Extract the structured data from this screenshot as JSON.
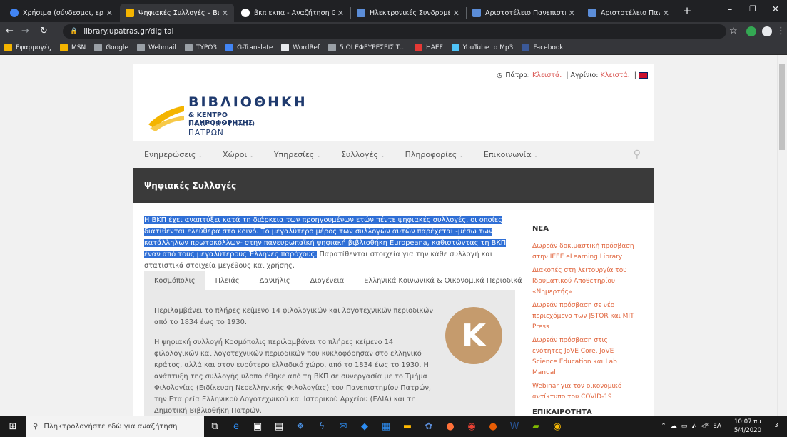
{
  "browser": {
    "tabs": [
      {
        "label": "Χρήσιμα (σύνδεσμοι, εργαλε",
        "color": "#4285f4"
      },
      {
        "label": "Ψηφιακές Συλλογές – Βιβλιοθ",
        "color": "#f4b400"
      },
      {
        "label": "βκπ εκπα - Αναζήτηση Goog",
        "color": "#ffffff"
      },
      {
        "label": "Ηλεκτρονικές Συνδρομές | Α",
        "color": "#5b8dd8"
      },
      {
        "label": "Αριστοτέλειο Πανεπιστήμιο",
        "color": "#5b8dd8"
      },
      {
        "label": "Αριστοτέλειο Πανεπιστήμιο",
        "color": "#5b8dd8"
      }
    ],
    "new_tab": "+",
    "address": "library.upatras.gr/digital",
    "bookmarks": [
      {
        "label": "Εφαρμογές",
        "color": "#f4b400"
      },
      {
        "label": "MSN",
        "color": "#f4b400"
      },
      {
        "label": "Google",
        "color": "#9aa0a6"
      },
      {
        "label": "Webmail",
        "color": "#9aa0a6"
      },
      {
        "label": "TYPO3",
        "color": "#9aa0a6"
      },
      {
        "label": "G-Translate",
        "color": "#4285f4"
      },
      {
        "label": "WordRef",
        "color": "#e8eaed"
      },
      {
        "label": "5.ΟΙ ΕΦΕΥΡΕΣΕΙΣ Τ...",
        "color": "#9aa0a6"
      },
      {
        "label": "HAEF",
        "color": "#e53935"
      },
      {
        "label": "YouTube to Mp3",
        "color": "#4fc3f7"
      },
      {
        "label": "Facebook",
        "color": "#3b5998"
      }
    ]
  },
  "site": {
    "top_info": {
      "patra_label": "Πάτρα:",
      "patra_status": "Κλειστά.",
      "agrinio_label": "| Αγρίνιο:",
      "agrinio_status": "Κλειστά.",
      "sep": "|"
    },
    "logo": {
      "line1": "ΒΙΒΛΙΟΘΗΚΗ",
      "line2": "& ΚΕΝΤΡΟ ΠΛΗΡΟΦΟΡΗΣΗΣ",
      "line3": "ΠΑΝΕΠΙΣΤΗΜΙΟ ΠΑΤΡΩΝ"
    },
    "menu": [
      "Ενημερώσεις",
      "Χώροι",
      "Υπηρεσίες",
      "Συλλογές",
      "Πληροφορίες",
      "Επικοινωνία"
    ],
    "page_title": "Ψηφιακές Συλλογές",
    "intro_selected": "Η ΒΚΠ έχει αναπτύξει κατά τη διάρκεια των προηγουμένων ετών πέντε ψηφιακές συλλογές, οι οποίες διατίθενται ελεύθερα στο κοινό. Το μεγαλύτερο μέρος των συλλογών αυτών παρέχεται -μέσω των κατάλληλων πρωτοκόλλων- στην πανευρωπαϊκή ψηφιακή βιβλιοθήκη Europeana, καθιστώντας τη ΒΚΠ έναν από τους μεγαλύτερους Έλληνες παρόχους.",
    "intro_rest": "Παρατίθενται στοιχεία για την κάθε συλλογή και στατιστικά στοιχεία μεγέθους και χρήσης.",
    "tabs": [
      "Κοσμόπολις",
      "Πλειάς",
      "Δανιήλις",
      "Διογένεια",
      "Ελληνικά Κοινωνικά & Οικονομικά Περιοδικά"
    ],
    "panel": {
      "p1": "Περιλαμβάνει το πλήρες κείμενο 14 φιλολογικών και λογοτεχνικών περιοδικών από το 1834 έως το 1930.",
      "p2": "Η ψηφιακή συλλογή Κοσμόπολις περιλαμβάνει το πλήρες κείμενο 14 φιλολογικών και λογοτεχνικών περιοδικών που κυκλοφόρησαν στο ελληνικό κράτος, αλλά και στον ευρύτερο ελλαδικό χώρο, από το 1834 έως το 1930. Η ανάπτυξη της συλλογής υλοποιήθηκε από τη ΒΚΠ σε συνεργασία με το Τμήμα Φιλολογίας (Ειδίκευση Νεοελληνικής Φιλολογίας) του Πανεπιστημίου Πατρών, την Εταιρεία Ελληνικού Λογοτεχνικού και Ιστορικού Αρχείου (ΕΛΙΑ) και τη Δημοτική Βιβλιοθήκη Πατρών.",
      "letter": "K"
    },
    "sidebar": {
      "news_title": "ΝΕΑ",
      "news": [
        "Δωρεάν δοκιμαστική πρόσβαση στην IEEE eLearning Library",
        "Διακοπές στη λειτουργία του Ιδρυματικού Αποθετηρίου «Νημερτής»",
        "Δωρεάν πρόσβαση σε νέο περιεχόμενο των JSTOR και MIT Press",
        "Δωρεάν πρόσβαση στις ενότητες JoVE Core, JoVE Science Education και Lab Manual",
        "Webinar για τον οικονομικό αντίκτυπο του COVID-19"
      ],
      "current_title": "ΕΠΙΚΑΙΡΟΤΗΤΑ"
    }
  },
  "taskbar": {
    "search_placeholder": "Πληκτρολογήστε εδώ για αναζήτηση",
    "lang": "ΕΛ",
    "time": "10:07 πμ",
    "date": "5/4/2020",
    "notif_count": "3"
  }
}
